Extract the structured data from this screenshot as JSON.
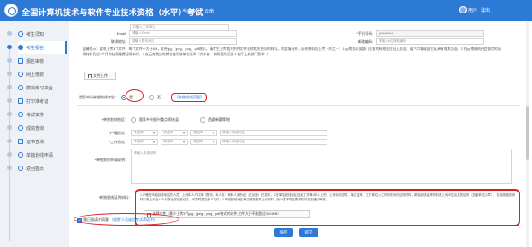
{
  "header": {
    "title": "全国计算机技术与软件专业技术资格（水平）考试",
    "region_label": "当前考区：",
    "region_value": "云南",
    "user_name": "用户",
    "logout": "退出"
  },
  "sidebar": {
    "items": [
      {
        "label": "考生须知",
        "icon": "notice-icon"
      },
      {
        "label": "考生报名",
        "icon": "register-icon",
        "active": true
      },
      {
        "label": "报名审核",
        "icon": "review-icon"
      },
      {
        "label": "网上缴费",
        "icon": "payment-icon"
      },
      {
        "label": "模拟练习平台",
        "icon": "practice-icon"
      },
      {
        "label": "打印准考证",
        "icon": "print-icon"
      },
      {
        "label": "考试安排",
        "icon": "schedule-icon"
      },
      {
        "label": "成绩查询",
        "icon": "score-icon"
      },
      {
        "label": "证书查询",
        "icon": "certificate-icon"
      },
      {
        "label": "单独划线申请",
        "icon": "apply-icon"
      },
      {
        "label": "返回首页",
        "icon": "home-icon"
      }
    ]
  },
  "form": {
    "email_label": "Email:",
    "email_placeholder": "请输入Email",
    "phone_label": "*手机号码:",
    "phone_value": "1**********",
    "contact_label": "联系地址:",
    "contact_placeholder": "请输入联系地址",
    "postcode_label": "邮政编码:",
    "postcode_placeholder": "请输入6位邮政编码",
    "top_placeholder": "请输入工作单位",
    "notice_text": "温馨提示：要求上传3个文件，每个文件不大于3M，支持jpg、jpeg、png、pdf格式，请考生上传相关附件文件去除相关合同的材料，除此情况外，证明材料应上传下列之一：1.云南省公安部门签发的有效居住证正反面；省户口簿或居住证具有效期页面。2.在云南缴纳社会保险的证明材料及近6个月的社保缴费证明材料。3.在云南就业的劳动合同或单位证明（文件名：按照提交至省人社厅上级部门要求...）",
    "upload_btn": "文件上传",
    "apply_label": "是否申请单独划线考生：",
    "yes": "是",
    "no": "否",
    "apply_link": "【单独划线范围】",
    "region_label": "*单独划线地区：",
    "opt1": "国家乡村振兴重点帮扶县",
    "opt2": "西藏新疆等地",
    "addr_label": "*户籍地址：",
    "work_label": "*工作地址：",
    "select_placeholder": "请选择",
    "detail_placeholder": "请输入详细地址",
    "desc_label": "*单独划线申请说明：",
    "desc_placeholder": "请输入申请说明",
    "proof_label": "*单独划线证明材料：",
    "proof_hint": "1.户籍在单独划线地区的人员，上传本人户口簿（首页、本人页）和本人身份证（正反面）扫描件；2.在单独划线地区连续工作满1年以上的，上传劳动合同、单位证明、工作单位为工作所在地的证明材料，单独划线证明材料请上传单位出具的证明（加盖单位公章），社保缴费证明材料请上传近12个月的社保缴费记录，可同时提交多个文件；3.单独划线地区考生请按要求上传材料，缺少或不符合要求的将无法通过审核。",
    "proof_btn": "选择文件（最少上传3个jpg、jpeg、png、pdf格式的文件,文件大小不能超过3024KB）",
    "agree_text": "我已阅读并同意",
    "agree_link": "《报考人员诚信考试承诺书》",
    "save_btn": "保存",
    "submit_btn": "提交"
  },
  "colors": {
    "brand": "#2d7ad6",
    "highlight": "#e02020"
  }
}
